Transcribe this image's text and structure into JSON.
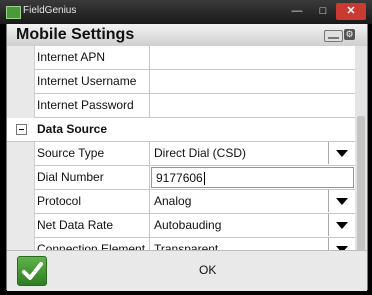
{
  "window": {
    "app_title": "FieldGenius"
  },
  "header": {
    "title": "Mobile Settings"
  },
  "rows_top": [
    {
      "label": "Internet APN",
      "value": ""
    },
    {
      "label": "Internet Username",
      "value": ""
    },
    {
      "label": "Internet Password",
      "value": ""
    }
  ],
  "section": {
    "label": "Data Source"
  },
  "rows_bottom": [
    {
      "label": "Source Type",
      "value": "Direct Dial (CSD)"
    },
    {
      "label": "Dial Number",
      "value": "9177606"
    },
    {
      "label": "Protocol",
      "value": "Analog"
    },
    {
      "label": "Net Data Rate",
      "value": "Autobauding"
    },
    {
      "label": "Connection Element",
      "value": "Transparent"
    }
  ],
  "footer": {
    "ok_label": "OK"
  }
}
